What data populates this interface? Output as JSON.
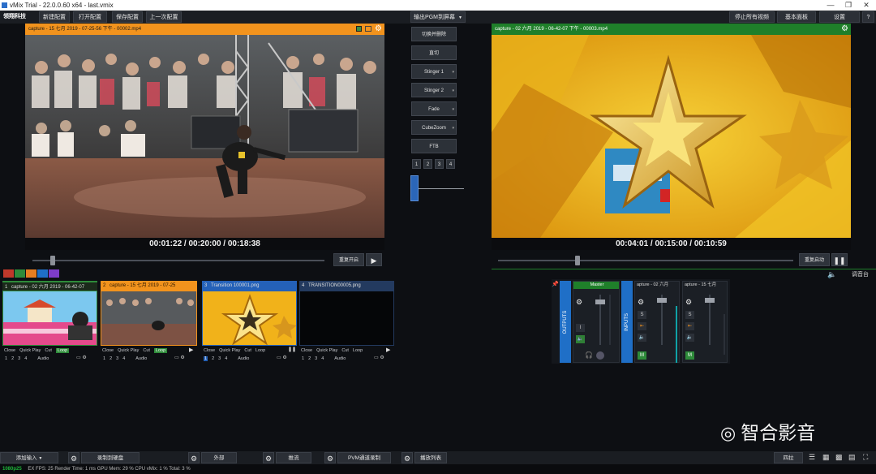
{
  "window": {
    "title": "vMix Trial - 22.0.0.60 x64 - last.vmix",
    "controls": [
      "—",
      "❐",
      "✕"
    ]
  },
  "topbar": {
    "brand": "领翔科技",
    "menu": [
      "新建配置",
      "打开配置",
      "保存配置",
      "上一次配置"
    ],
    "output_label": "输出PGM到屏幕",
    "right_buttons": [
      "停止所有视频",
      "基本面板",
      "设置",
      "?"
    ]
  },
  "preview": {
    "title": "capture - 15 七月 2019 - 07-25-56 下午 - 00002.mp4",
    "time": "00:01:22  /  00:20:00  /  00:18:38",
    "loop_label": "重复开启",
    "position": 0.07
  },
  "program": {
    "title": "capture - 02 六月 2019 - 06-42-07 下午 - 00003.mp4",
    "time": "00:04:01  /  00:15:00  /  00:10:59",
    "loop_label": "重复启动",
    "position": 0.27
  },
  "transitions": {
    "buttons": [
      "切换并删除",
      "直切",
      "Stinger 1",
      "Stinger 2",
      "Fade",
      "CubeZoom",
      "FTB"
    ],
    "numbers": [
      "1",
      "2",
      "3",
      "4"
    ]
  },
  "colors": {
    "preview_accent": "#f2931d",
    "program_accent": "#1f7f2a",
    "input_active_blue": "#2461b8",
    "mixer_blue": "#1f6fc7",
    "swatches": [
      "#c0392b",
      "#2e8b3a",
      "#e67e22",
      "#1f6fc7",
      "#7d3cc8"
    ]
  },
  "status_side": {
    "audio_label": "调音台"
  },
  "inputs": [
    {
      "index": "1",
      "title": "capture - 02 六月 2019 - 06-42-07",
      "loop_on": true
    },
    {
      "index": "2",
      "title": "capture - 15 七月 2019 - 07-25",
      "loop_on": true
    },
    {
      "index": "3",
      "title": "Transition 100001.png",
      "loop_on": false
    },
    {
      "index": "4",
      "title": "TRANSITION00005.png",
      "loop_on": false
    }
  ],
  "input_controls": {
    "row1": [
      "Close",
      "Quick Play",
      "Cut",
      "Loop"
    ],
    "row2": [
      "1",
      "2",
      "3",
      "4",
      "Audio"
    ]
  },
  "mixer": {
    "outputs_label": "OUTPUTS",
    "inputs_label": "INPUTS",
    "master_label": "Master",
    "channels": [
      "apture - 02 六月",
      "apture - 15 七月"
    ],
    "m_label": "M",
    "s_label": "S",
    "i_label": "I"
  },
  "bottom": {
    "add_input": "添加输入",
    "buttons": [
      "录制到硬盘",
      "外部",
      "推流",
      "PVM通道录制",
      "播放列表"
    ],
    "right_label": "四拉"
  },
  "status": {
    "resolution": "1080p25",
    "text": "EX  FPS: 25   Render Time: 1 ms   GPU Mem: 29 %   CPU vMix: 1 %   Total: 3 %"
  },
  "watermark": {
    "text": "智合影音"
  }
}
